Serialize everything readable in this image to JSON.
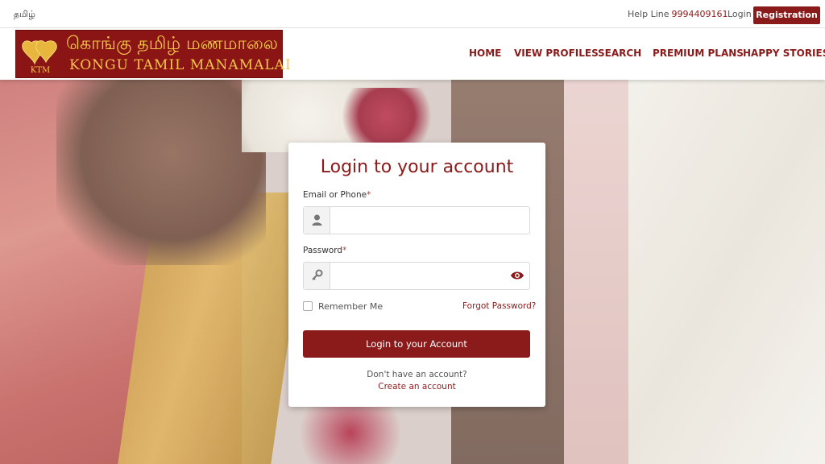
{
  "topbar": {
    "language": "தமிழ்",
    "helpline_label": "Help Line",
    "helpline_number": "9994409161",
    "login": "Login",
    "registration": "Registration"
  },
  "logo": {
    "tamil": "கொங்கு தமிழ் மணமாலை",
    "english": "KONGU TAMIL MANAMALAI",
    "monogram": "KTM"
  },
  "nav": [
    "HOME",
    "VIEW PROFILES",
    "SEARCH",
    "PREMIUM PLANS",
    "HAPPY STORIES"
  ],
  "login_card": {
    "title": "Login to your account",
    "email_label": "Email or Phone",
    "password_label": "Password",
    "required_mark": "*",
    "email_value": "",
    "password_value": "",
    "remember_me": "Remember Me",
    "forgot_password": "Forgot Password?",
    "submit": "Login to your Account",
    "no_account": "Don't have an account?",
    "create_account": "Create an account"
  },
  "colors": {
    "brand": "#8b1a1a",
    "logo_gold": "#f3c64a"
  }
}
